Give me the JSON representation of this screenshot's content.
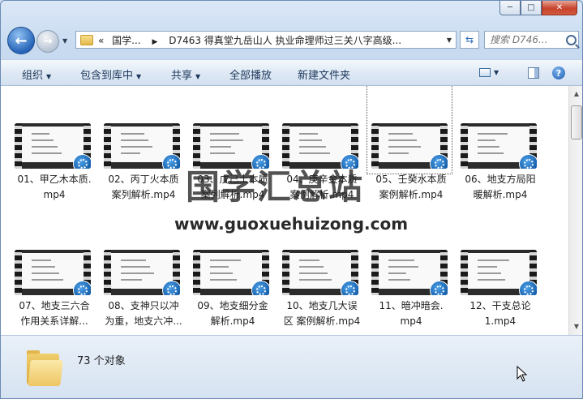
{
  "window": {
    "caption": {
      "minimize": "─",
      "maximize": "□",
      "close": "✕"
    }
  },
  "nav": {
    "address_prefix": "«",
    "breadcrumb": [
      "国学...",
      "D7463 得真堂九岳山人 执业命理师过三关八字高级..."
    ],
    "search_placeholder": "搜索 D746..."
  },
  "toolbar": {
    "organize": "组织",
    "include_in_library": "包含到库中",
    "share": "共享",
    "play_all": "全部播放",
    "new_folder": "新建文件夹"
  },
  "files": [
    {
      "line1": "01、甲乙木本质.",
      "line2": "mp4"
    },
    {
      "line1": "02、丙丁火本质",
      "line2": "案列解析.mp4"
    },
    {
      "line1": "03、戊己土本质",
      "line2": "案列解析.mp4"
    },
    {
      "line1": "04、庚辛金本质",
      "line2": "案例解析.mp4"
    },
    {
      "line1": "05、壬癸水本质",
      "line2": "案例解析.mp4"
    },
    {
      "line1": "06、地支方局阳",
      "line2": "暖解析.mp4"
    },
    {
      "line1": "07、地支三六合",
      "line2": "作用关系详解..."
    },
    {
      "line1": "08、支神只以冲",
      "line2": "为重，地支六冲..."
    },
    {
      "line1": "09、地支细分金",
      "line2": "解析.mp4"
    },
    {
      "line1": "10、地支几大误",
      "line2": "区 案例解析.mp4"
    },
    {
      "line1": "11、暗冲暗会.",
      "line2": "mp4"
    },
    {
      "line1": "12、干支总论",
      "line2": "1.mp4"
    }
  ],
  "watermark": {
    "cn": "国学汇总站",
    "url": "www.guoxuehuizong.com"
  },
  "details": {
    "count": "73 个对象"
  },
  "colors": {
    "accent": "#1e395b",
    "play_badge": "#135ca8"
  }
}
